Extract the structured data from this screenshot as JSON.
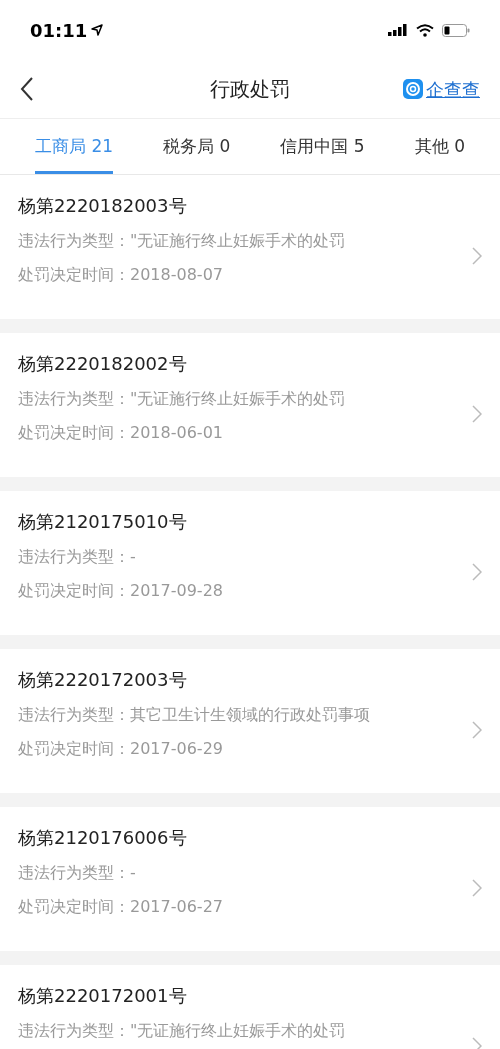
{
  "status_bar": {
    "time": "01:11"
  },
  "header": {
    "title": "行政处罚",
    "brand": "企查查"
  },
  "tabs": [
    {
      "label": "工商局 21",
      "selected": true
    },
    {
      "label": "税务局 0",
      "selected": false
    },
    {
      "label": "信用中国 5",
      "selected": false
    },
    {
      "label": "其他 0",
      "selected": false
    }
  ],
  "records": [
    {
      "title": "杨第2220182003号",
      "type_label": "违法行为类型：",
      "type_value": "\"无证施行终止妊娠手术的处罚",
      "date_label": "处罚决定时间：",
      "date_value": "2018-08-07"
    },
    {
      "title": "杨第2220182002号",
      "type_label": "违法行为类型：",
      "type_value": "\"无证施行终止妊娠手术的处罚",
      "date_label": "处罚决定时间：",
      "date_value": "2018-06-01"
    },
    {
      "title": "杨第2120175010号",
      "type_label": "违法行为类型：",
      "type_value": "-",
      "date_label": "处罚决定时间：",
      "date_value": "2017-09-28"
    },
    {
      "title": "杨第2220172003号",
      "type_label": "违法行为类型：",
      "type_value": "其它卫生计生领域的行政处罚事项",
      "date_label": "处罚决定时间：",
      "date_value": "2017-06-29"
    },
    {
      "title": "杨第2120176006号",
      "type_label": "违法行为类型：",
      "type_value": "-",
      "date_label": "处罚决定时间：",
      "date_value": "2017-06-27"
    },
    {
      "title": "杨第2220172001号",
      "type_label": "违法行为类型：",
      "type_value": "\"无证施行终止妊娠手术的处罚"
    }
  ]
}
